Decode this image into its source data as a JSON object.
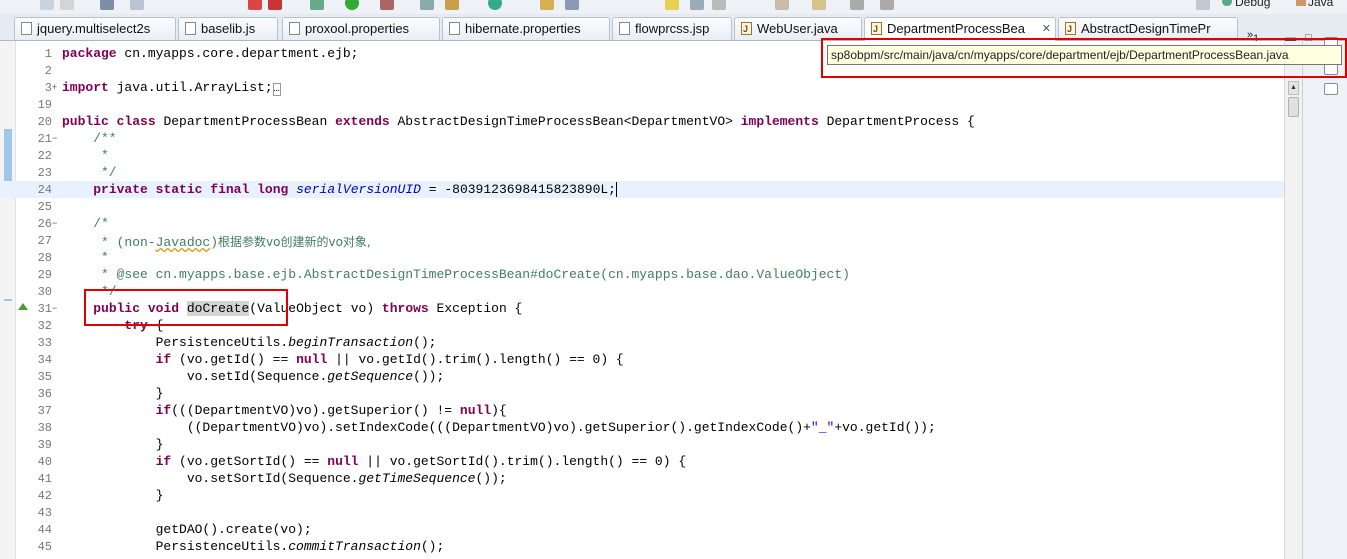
{
  "toolbar": {
    "perspectives": [
      {
        "label": "Debug",
        "icon": "debug-perspective-icon"
      },
      {
        "label": "Java",
        "icon": "java-perspective-icon"
      }
    ]
  },
  "tabs": [
    {
      "label": "jquery.multiselect2s",
      "icon": "js-file-icon",
      "active": false
    },
    {
      "label": "baselib.js",
      "icon": "js-file-icon",
      "active": false
    },
    {
      "label": "proxool.properties",
      "icon": "properties-file-icon",
      "active": false
    },
    {
      "label": "hibernate.properties",
      "icon": "properties-file-icon",
      "active": false
    },
    {
      "label": "flowprcss.jsp",
      "icon": "jsp-file-icon",
      "active": false
    },
    {
      "label": "WebUser.java",
      "icon": "java-file-icon",
      "active": false
    },
    {
      "label": "DepartmentProcessBea",
      "icon": "java-file-icon",
      "active": true,
      "close": "✕"
    },
    {
      "label": "AbstractDesignTimePr",
      "icon": "java-file-icon",
      "active": false
    }
  ],
  "tabs_overflow": {
    "symbol": "»",
    "count": "1"
  },
  "tooltip": {
    "path": "sp8obpm/src/main/java/cn/myapps/core/department/ejb/DepartmentProcessBean.java"
  },
  "editor": {
    "lines": [
      {
        "n": "1",
        "t": "package cn.myapps.core.department.ejb;"
      },
      {
        "n": "2",
        "t": ""
      },
      {
        "n": "3",
        "t": "import java.util.ArrayList;…",
        "fold": "+"
      },
      {
        "n": "19",
        "t": ""
      },
      {
        "n": "20",
        "t": "public class DepartmentProcessBean extends AbstractDesignTimeProcessBean<DepartmentVO> implements DepartmentProcess {"
      },
      {
        "n": "21",
        "t": "    /**",
        "fold": "−"
      },
      {
        "n": "22",
        "t": "     *"
      },
      {
        "n": "23",
        "t": "     */"
      },
      {
        "n": "24",
        "t": "    private static final long serialVersionUID = -8039123698415823890L;"
      },
      {
        "n": "25",
        "t": ""
      },
      {
        "n": "26",
        "t": "    /*",
        "fold": "−"
      },
      {
        "n": "27",
        "t": "     * (non-Javadoc)根据参数vo创建新的vo对象,"
      },
      {
        "n": "28",
        "t": "     *"
      },
      {
        "n": "29",
        "t": "     * @see cn.myapps.base.ejb.AbstractDesignTimeProcessBean#doCreate(cn.myapps.base.dao.ValueObject)"
      },
      {
        "n": "30",
        "t": "     */"
      },
      {
        "n": "31",
        "t": "    public void doCreate(ValueObject vo) throws Exception {",
        "fold": "−"
      },
      {
        "n": "32",
        "t": "        try {"
      },
      {
        "n": "33",
        "t": "            PersistenceUtils.beginTransaction();"
      },
      {
        "n": "34",
        "t": "            if (vo.getId() == null || vo.getId().trim().length() == 0) {"
      },
      {
        "n": "35",
        "t": "                vo.setId(Sequence.getSequence());"
      },
      {
        "n": "36",
        "t": "            }"
      },
      {
        "n": "37",
        "t": "            if(((DepartmentVO)vo).getSuperior() != null){"
      },
      {
        "n": "38",
        "t": "                ((DepartmentVO)vo).setIndexCode(((DepartmentVO)vo).getSuperior().getIndexCode()+\"_\"+vo.getId());"
      },
      {
        "n": "39",
        "t": "            }"
      },
      {
        "n": "40",
        "t": "            if (vo.getSortId() == null || vo.getSortId().trim().length() == 0) {"
      },
      {
        "n": "41",
        "t": "                vo.setSortId(Sequence.getTimeSequence());"
      },
      {
        "n": "42",
        "t": "            }"
      },
      {
        "n": "43",
        "t": ""
      },
      {
        "n": "44",
        "t": "            getDAO().create(vo);"
      },
      {
        "n": "45",
        "t": "            PersistenceUtils.commitTransaction();"
      }
    ]
  },
  "colors": {
    "keyword": "#7f0055",
    "comment": "#3f7f5f",
    "field": "#0000c0",
    "string": "#2a00ff",
    "highlight_box": "#e00000"
  }
}
